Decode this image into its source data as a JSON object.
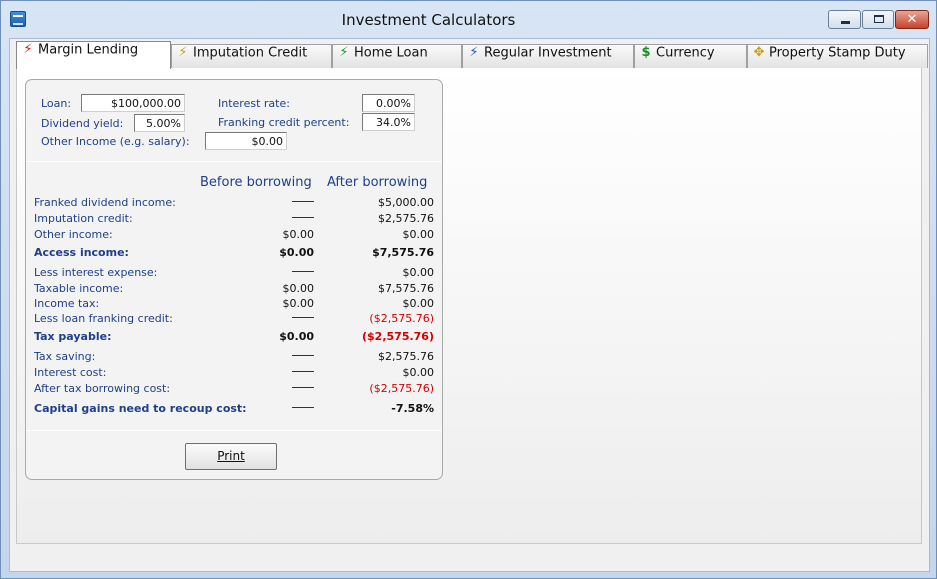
{
  "window": {
    "title": "Investment Calculators",
    "app_icon": "calculator-app-icon",
    "controls": {
      "minimize": "minimize-icon",
      "maximize": "maximize-icon",
      "close": "close-icon"
    }
  },
  "tabs": [
    {
      "label": "Margin Lending",
      "icon": "lightning-red-icon",
      "active": true
    },
    {
      "label": "Imputation Credit",
      "icon": "lightning-yellow-icon",
      "active": false
    },
    {
      "label": "Home Loan",
      "icon": "lightning-green-icon",
      "active": false
    },
    {
      "label": "Regular Investment",
      "icon": "lightning-blue-icon",
      "active": false
    },
    {
      "label": "Currency",
      "icon": "dollar-icon",
      "active": false
    },
    {
      "label": "Property Stamp Duty",
      "icon": "stamp-icon",
      "active": false
    }
  ],
  "inputs": {
    "loan": {
      "label": "Loan:",
      "value": "$100,000.00"
    },
    "interest_rate": {
      "label": "Interest rate:",
      "value": "0.00%"
    },
    "dividend_yield": {
      "label": "Dividend yield:",
      "value": "5.00%"
    },
    "franking_credit": {
      "label": "Franking credit percent:",
      "value": "34.0%"
    },
    "other_income": {
      "label": "Other Income (e.g. salary):",
      "value": "$0.00"
    }
  },
  "columns": {
    "before": "Before borrowing",
    "after": "After borrowing"
  },
  "rows": [
    {
      "label": "Franked dividend income:",
      "before": "",
      "after": "$5,000.00",
      "bold": false,
      "neg": false
    },
    {
      "label": "Imputation credit:",
      "before": "",
      "after": "$2,575.76",
      "bold": false,
      "neg": false
    },
    {
      "label": "Other income:",
      "before": "$0.00",
      "after": "$0.00",
      "bold": false,
      "neg": false
    },
    {
      "label": "Access income:",
      "before": "$0.00",
      "after": "$7,575.76",
      "bold": true,
      "neg": false
    },
    {
      "label": "Less interest expense:",
      "before": "",
      "after": "$0.00",
      "bold": false,
      "neg": false
    },
    {
      "label": "Taxable income:",
      "before": "$0.00",
      "after": "$7,575.76",
      "bold": false,
      "neg": false
    },
    {
      "label": "Income tax:",
      "before": "$0.00",
      "after": "$0.00",
      "bold": false,
      "neg": false
    },
    {
      "label": "Less loan franking credit:",
      "before": "",
      "after": "($2,575.76)",
      "bold": false,
      "neg": true
    },
    {
      "label": "Tax payable:",
      "before": "$0.00",
      "after": "($2,575.76)",
      "bold": true,
      "neg": true
    },
    {
      "label": "Tax saving:",
      "before": "",
      "after": "$2,575.76",
      "bold": false,
      "neg": false
    },
    {
      "label": "Interest cost:",
      "before": "",
      "after": "$0.00",
      "bold": false,
      "neg": false
    },
    {
      "label": "After tax borrowing cost:",
      "before": "",
      "after": "($2,575.76)",
      "bold": false,
      "neg": true
    },
    {
      "label": "Capital gains need to recoup cost:",
      "before": "",
      "after": "-7.58%",
      "bold": true,
      "neg": false
    }
  ],
  "print_button": {
    "label": "Print"
  },
  "colors": {
    "label_blue": "#1f3f8a",
    "negative_red": "#d40000"
  }
}
